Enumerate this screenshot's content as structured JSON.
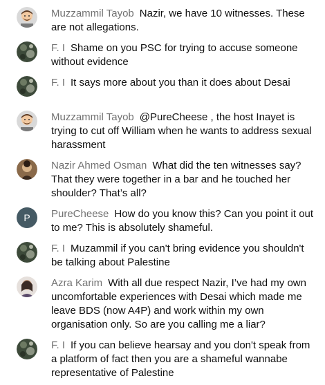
{
  "messages": [
    {
      "author": "Muzzammil Tayob",
      "text": "Nazir, we have 10 witnesses. These are not allegations.",
      "avatar_icon": "cartoon-avatar"
    },
    {
      "author": "F. I",
      "text": "Shame on you PSC for trying to accuse someone without evidence",
      "avatar_icon": "photo-avatar"
    },
    {
      "author": "F. I",
      "text": "It says more about you than it does about Desai",
      "avatar_icon": "photo-avatar"
    },
    {
      "author": "Muzzammil Tayob",
      "text": "@PureCheese , the host Inayet is trying to cut off William when he wants to address sexual harassment",
      "avatar_icon": "cartoon-avatar"
    },
    {
      "author": "Nazir Ahmed Osman",
      "text": "What did the ten witnesses say? That they were together in a bar and he touched her shoulder? That’s all?",
      "avatar_icon": "photo-avatar"
    },
    {
      "author": "PureCheese",
      "text": "How do you know this? Can you point it out to me? This is absolutely shameful.",
      "avatar_letter": "P"
    },
    {
      "author": "F. I",
      "text": "Muzammil if you can't bring evidence you shouldn't be talking about Palestine",
      "avatar_icon": "photo-avatar"
    },
    {
      "author": "Azra Karim",
      "text": "With all due respect Nazir, I’ve had my own uncomfortable experiences with Desai which made me leave BDS (now A4P) and work within my own organisation only. So are you calling me a liar?",
      "avatar_icon": "photo-avatar"
    },
    {
      "author": "F. I",
      "text": "If you can believe hearsay and you don't speak from a platform of fact then you are a shameful wannabe representative of Palestine",
      "avatar_icon": "photo-avatar"
    }
  ],
  "colors": {
    "author": "#717171",
    "text": "#0f0f0f",
    "letter_avatar_bg": "#455a64"
  }
}
